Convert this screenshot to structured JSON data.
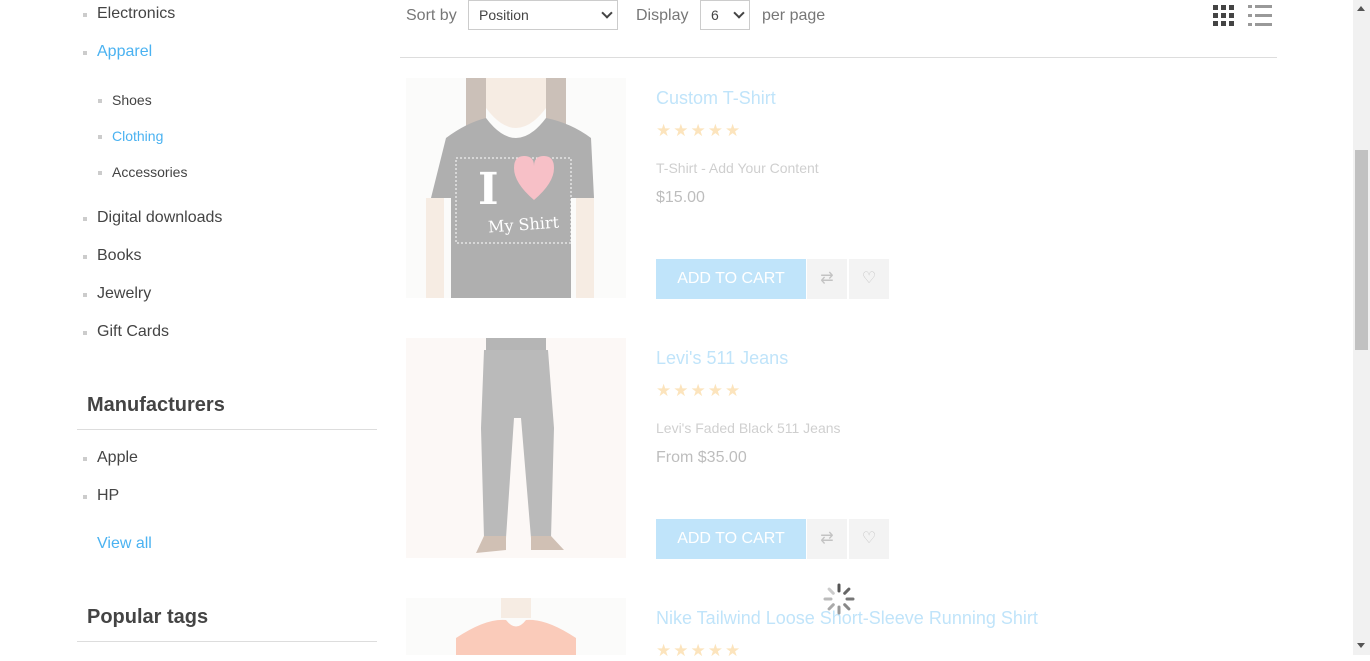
{
  "sidebar": {
    "categories": [
      {
        "label": "Electronics"
      },
      {
        "label": "Apparel"
      },
      {
        "label": "Digital downloads"
      },
      {
        "label": "Books"
      },
      {
        "label": "Jewelry"
      },
      {
        "label": "Gift Cards"
      }
    ],
    "subcategories": [
      {
        "label": "Shoes"
      },
      {
        "label": "Clothing"
      },
      {
        "label": "Accessories"
      }
    ],
    "manufacturers": {
      "title": "Manufacturers",
      "items": [
        {
          "label": "Apple"
        },
        {
          "label": "HP"
        }
      ],
      "view_all": "View all"
    },
    "popular_tags": {
      "title": "Popular tags"
    }
  },
  "toolbar": {
    "sort_label": "Sort by",
    "sort_value": "Position",
    "display_label": "Display",
    "display_value": "6",
    "per_page": "per page"
  },
  "products": [
    {
      "title": "Custom T-Shirt",
      "description": "T-Shirt - Add Your Content",
      "price": "$15.00",
      "add_to_cart": "ADD TO CART",
      "rating": 5,
      "image_text_1": "I",
      "image_text_2": "My Shirt"
    },
    {
      "title": "Levi's 511 Jeans",
      "description": "Levi's Faded Black 511 Jeans",
      "price": "From $35.00",
      "add_to_cart": "ADD TO CART",
      "rating": 5
    },
    {
      "title": "Nike Tailwind Loose Short-Sleeve Running Shirt",
      "rating": 5
    }
  ],
  "colors": {
    "accent": "#4ab2f1",
    "text": "#444444"
  }
}
